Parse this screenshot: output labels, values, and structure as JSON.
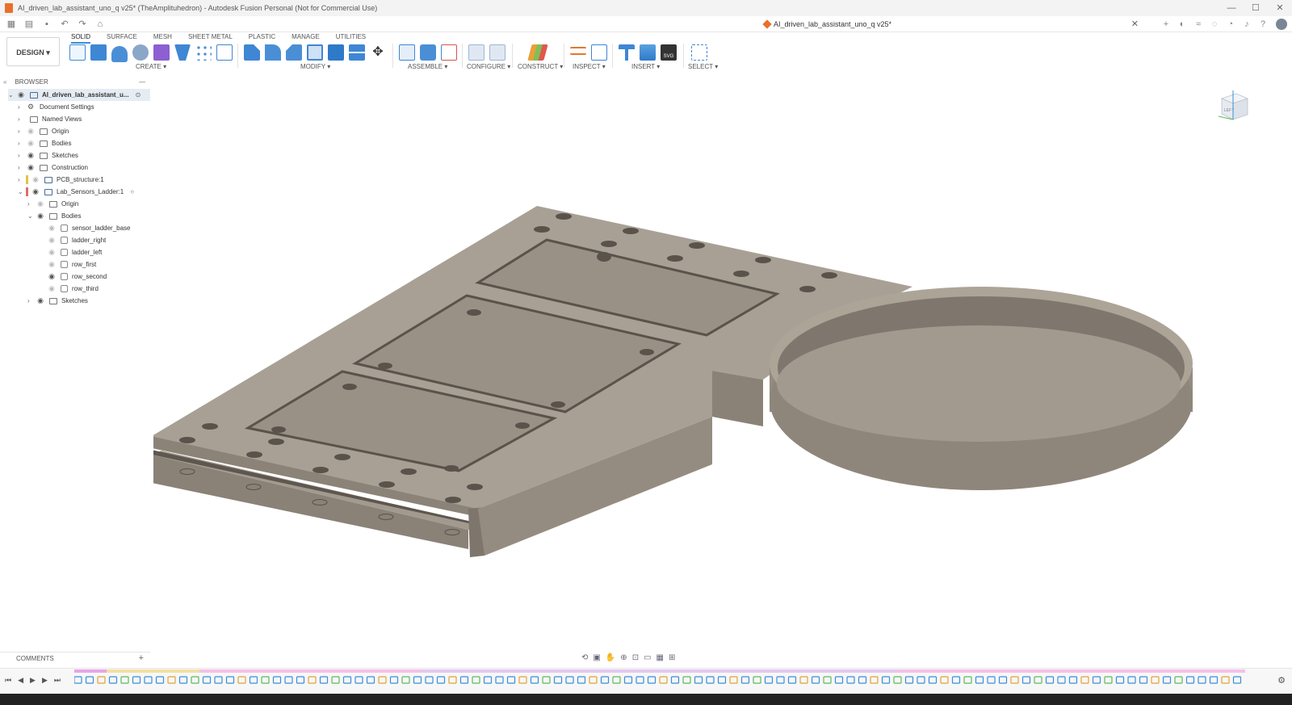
{
  "window": {
    "title": "AI_driven_lab_assistant_uno_q v25* (TheAmplituhedron) - Autodesk Fusion Personal (Not for Commercial Use)",
    "controls": [
      "—",
      "☐",
      "✕"
    ]
  },
  "document": {
    "tab_title": "AI_driven_lab_assistant_uno_q v25*",
    "close": "✕"
  },
  "ribbon": {
    "workspace": "DESIGN ▾",
    "tabs": [
      "SOLID",
      "SURFACE",
      "MESH",
      "SHEET METAL",
      "PLASTIC",
      "MANAGE",
      "UTILITIES"
    ],
    "active_tab": "SOLID",
    "groups": {
      "create": "CREATE ▾",
      "modify": "MODIFY ▾",
      "assemble": "ASSEMBLE ▾",
      "configure": "CONFIGURE ▾",
      "construct": "CONSTRUCT ▾",
      "inspect": "INSPECT ▾",
      "insert": "INSERT ▾",
      "select": "SELECT ▾"
    }
  },
  "browser": {
    "header": "BROWSER",
    "items": [
      {
        "label": "AI_driven_lab_assistant_u..."
      },
      {
        "label": "Document Settings"
      },
      {
        "label": "Named Views"
      },
      {
        "label": "Origin"
      },
      {
        "label": "Bodies"
      },
      {
        "label": "Sketches"
      },
      {
        "label": "Construction"
      },
      {
        "label": "PCB_structure:1"
      },
      {
        "label": "Lab_Sensors_Ladder:1"
      },
      {
        "label": "Origin"
      },
      {
        "label": "Bodies"
      },
      {
        "label": "sensor_ladder_base"
      },
      {
        "label": "ladder_right"
      },
      {
        "label": "ladder_left"
      },
      {
        "label": "row_first"
      },
      {
        "label": "row_second"
      },
      {
        "label": "row_third"
      },
      {
        "label": "Sketches"
      }
    ]
  },
  "viewcube": {
    "face": "LEFT"
  },
  "comments": {
    "label": "COMMENTS",
    "add": "+"
  },
  "colors": {
    "accent": "#3b8ed8",
    "model_top": "#a39a8f",
    "model_side": "#877e73",
    "model_dark": "#6d655c"
  }
}
